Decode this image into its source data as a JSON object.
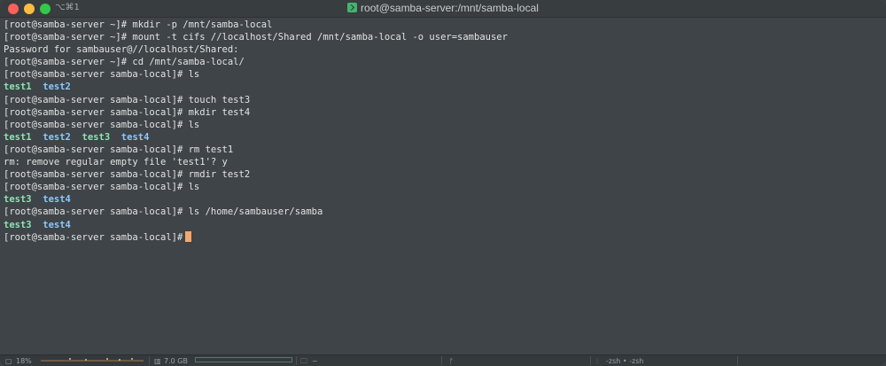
{
  "window": {
    "shortcut": "⌥⌘1",
    "title": "root@samba-server:/mnt/samba-local"
  },
  "terminal": {
    "lines": [
      [
        {
          "text": "[root@samba-server ~]# mkdir -p /mnt/samba-local"
        }
      ],
      [
        {
          "text": "[root@samba-server ~]# mount -t cifs //localhost/Shared /mnt/samba-local -o user=sambauser"
        }
      ],
      [
        {
          "text": "Password for sambauser@//localhost/Shared:"
        }
      ],
      [
        {
          "text": "[root@samba-server ~]# cd /mnt/samba-local/"
        }
      ],
      [
        {
          "text": "[root@samba-server samba-local]# ls"
        }
      ],
      [
        {
          "text": "test1",
          "cls": "dir-green"
        },
        {
          "text": "  "
        },
        {
          "text": "test2",
          "cls": "dir-blue"
        }
      ],
      [
        {
          "text": "[root@samba-server samba-local]# touch test3"
        }
      ],
      [
        {
          "text": "[root@samba-server samba-local]# mkdir test4"
        }
      ],
      [
        {
          "text": "[root@samba-server samba-local]# ls"
        }
      ],
      [
        {
          "text": "test1",
          "cls": "dir-green"
        },
        {
          "text": "  "
        },
        {
          "text": "test2",
          "cls": "dir-blue"
        },
        {
          "text": "  "
        },
        {
          "text": "test3",
          "cls": "dir-green"
        },
        {
          "text": "  "
        },
        {
          "text": "test4",
          "cls": "dir-blue"
        }
      ],
      [
        {
          "text": "[root@samba-server samba-local]# rm test1"
        }
      ],
      [
        {
          "text": "rm: remove regular empty file 'test1'? y"
        }
      ],
      [
        {
          "text": "[root@samba-server samba-local]# rmdir test2"
        }
      ],
      [
        {
          "text": "[root@samba-server samba-local]# ls"
        }
      ],
      [
        {
          "text": "test3",
          "cls": "dir-green"
        },
        {
          "text": "  "
        },
        {
          "text": "test4",
          "cls": "dir-blue"
        }
      ],
      [
        {
          "text": "[root@samba-server samba-local]# ls /home/sambauser/samba"
        }
      ],
      [
        {
          "text": "test3",
          "cls": "dir-green"
        },
        {
          "text": "  "
        },
        {
          "text": "test4",
          "cls": "dir-blue"
        }
      ],
      [
        {
          "text": "[root@samba-server samba-local]#"
        },
        {
          "cursor": true
        }
      ]
    ]
  },
  "status": {
    "cpu": "18%",
    "memory": "7.0 GB",
    "directory": "~",
    "git_icon": "git-branch-icon",
    "shells": "-zsh • -zsh",
    "colors": {
      "cpu_graph": "#c9a25a",
      "memory_bar": "#5e7270"
    }
  }
}
